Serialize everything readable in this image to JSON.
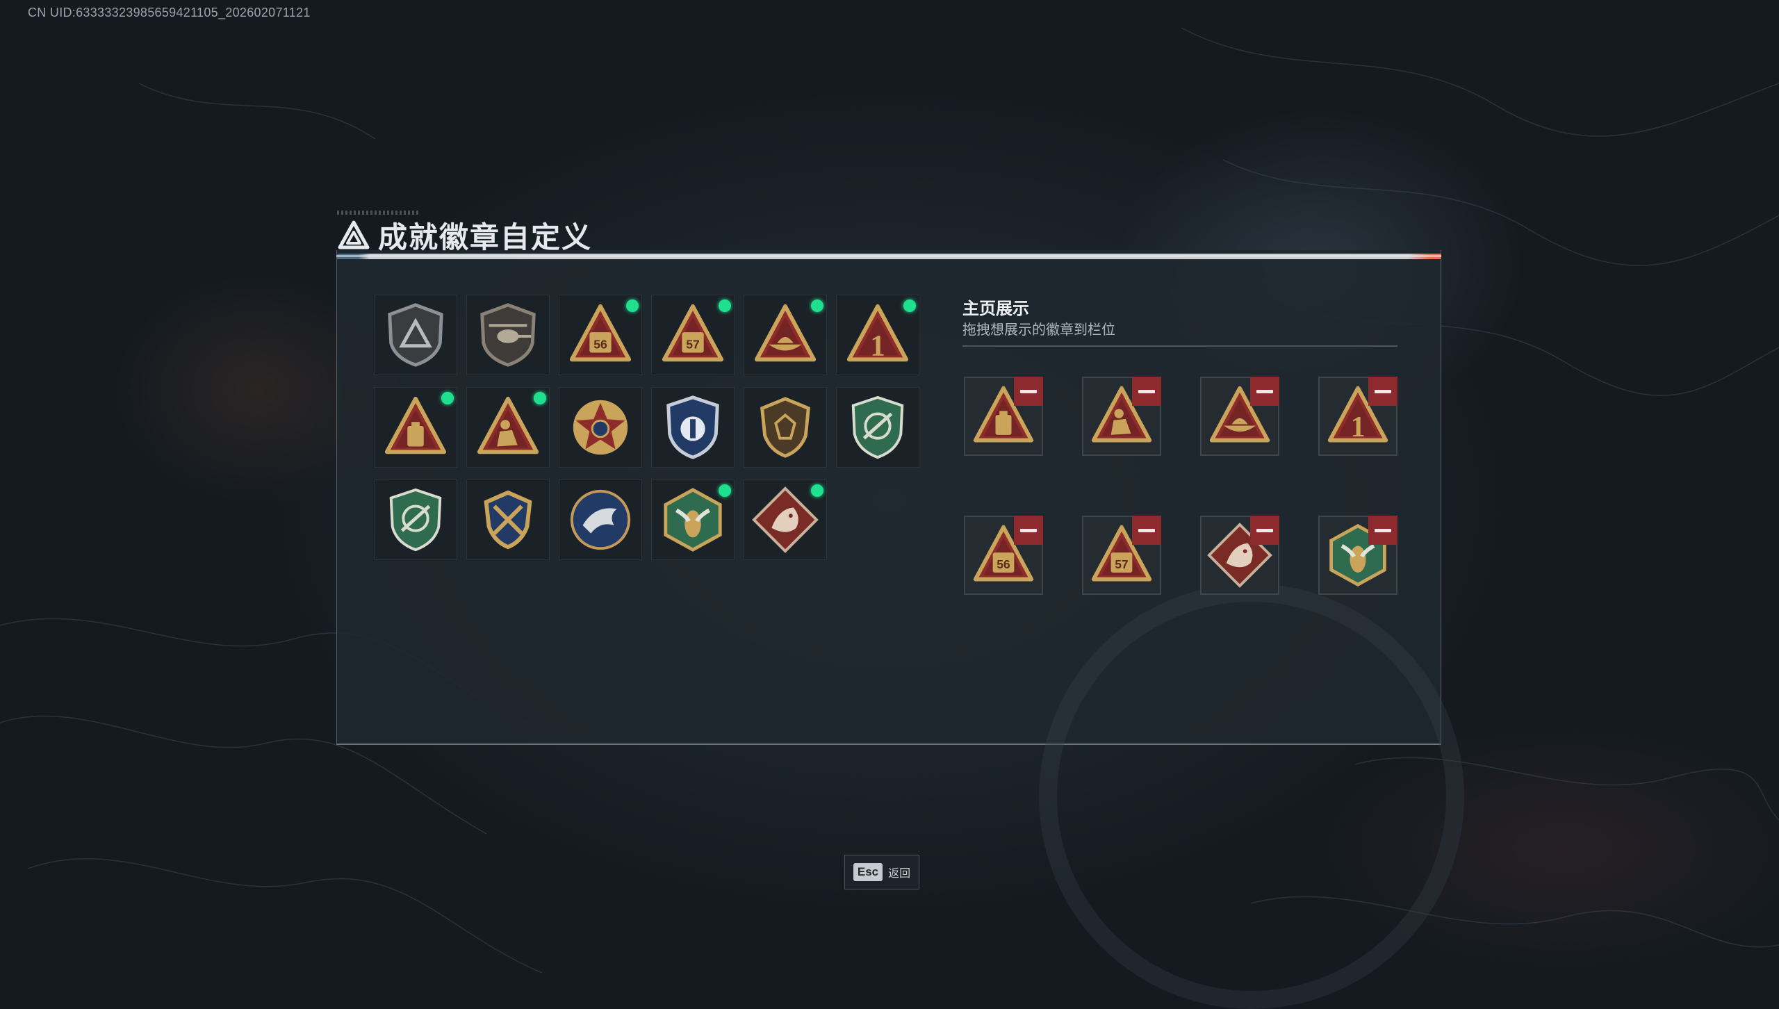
{
  "uid_text": "CN UID:63333323985659421105_202602071121",
  "window": {
    "title": "成就徽章自定义"
  },
  "colors": {
    "new_dot": "#1ee08e",
    "remove": "#8c2a2d",
    "gold": "#c9a45a",
    "red": "#8e2c2a",
    "green": "#2f6b4e",
    "navy": "#223a66"
  },
  "badges": [
    {
      "icon": "grey-triangle-shield-badge",
      "new": false
    },
    {
      "icon": "helicopter-shield-badge",
      "new": false
    },
    {
      "icon": "badge-56-triangle",
      "new": true,
      "text": "56"
    },
    {
      "icon": "badge-57-triangle",
      "new": true,
      "text": "57"
    },
    {
      "icon": "boat-triangle-badge",
      "new": true
    },
    {
      "icon": "number-one-triangle-badge",
      "new": true,
      "text": "1"
    },
    {
      "icon": "backpack-triangle-badge",
      "new": true
    },
    {
      "icon": "kneeling-soldier-triangle-badge",
      "new": true
    },
    {
      "icon": "red-star-medal-badge",
      "new": false
    },
    {
      "icon": "blue-police-shield-badge",
      "new": false
    },
    {
      "icon": "gold-gem-shield-badge",
      "new": false
    },
    {
      "icon": "green-rifle-crest-badge",
      "new": false
    },
    {
      "icon": "green-rifle-crest-badge-2",
      "new": false
    },
    {
      "icon": "gold-wings-sword-badge",
      "new": false
    },
    {
      "icon": "eagle-round-badge",
      "new": false
    },
    {
      "icon": "hornet-hexagon-badge",
      "new": true
    },
    {
      "icon": "dragon-diamond-badge",
      "new": true
    }
  ],
  "showcase": {
    "title": "主页展示",
    "subtitle": "拖拽想展示的徽章到栏位",
    "slots": [
      "backpack-triangle-badge",
      "kneeling-soldier-triangle-badge",
      "boat-triangle-badge",
      "number-one-triangle-badge",
      "badge-56-triangle",
      "badge-57-triangle",
      "dragon-diamond-badge",
      "hornet-hexagon-badge"
    ]
  },
  "footer": {
    "key": "Esc",
    "label": "返回"
  }
}
